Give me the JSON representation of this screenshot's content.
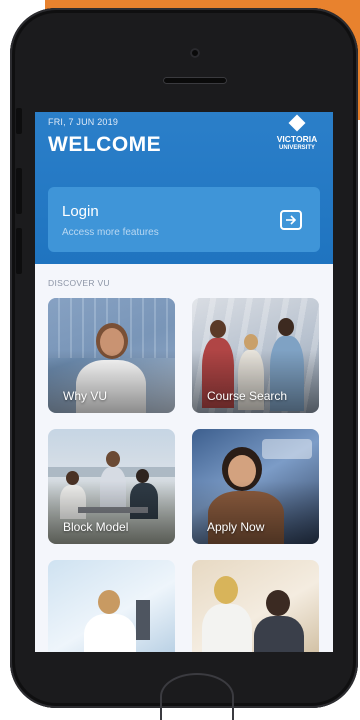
{
  "header": {
    "date": "FRI, 7 JUN 2019",
    "title": "WELCOME",
    "logo_line1": "VICTORIA",
    "logo_line2": "UNIVERSITY"
  },
  "login": {
    "title": "Login",
    "subtitle": "Access more features",
    "icon": "login-arrow-icon"
  },
  "discover": {
    "label": "DISCOVER VU",
    "tiles": [
      {
        "label": "Why VU"
      },
      {
        "label": "Course Search"
      },
      {
        "label": "Block Model"
      },
      {
        "label": "Apply Now"
      },
      {
        "label": ""
      },
      {
        "label": ""
      }
    ]
  },
  "colors": {
    "header_blue": "#2b7fc9",
    "card_blue": "#3f95d8",
    "background_orange": "#e8822e"
  }
}
